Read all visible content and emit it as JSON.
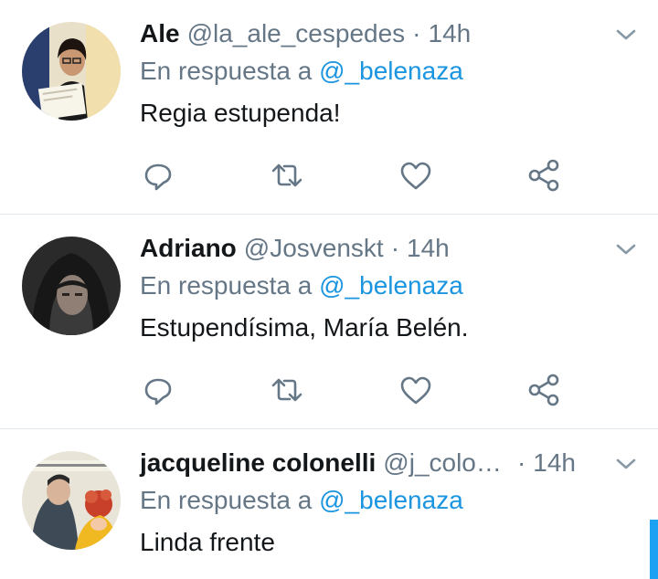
{
  "tweets": [
    {
      "name": "Ale",
      "handle": "@la_ale_cespedes",
      "separator": "·",
      "time": "14h",
      "reply_prefix": "En respuesta a",
      "reply_to": "@_belenaza",
      "text": "Regia estupenda!",
      "avatar": "avatar-photo-woman-diploma"
    },
    {
      "name": "Adriano",
      "handle": "@Josvenskt",
      "separator": "·",
      "time": "14h",
      "reply_prefix": "En respuesta a",
      "reply_to": "@_belenaza",
      "text": "Estupendísima, María Belén.",
      "avatar": "avatar-photo-man-hood"
    },
    {
      "name": "jacqueline colonelli",
      "handle": "@j_colon…",
      "separator": "·",
      "time": "14h",
      "reply_prefix": "En respuesta a",
      "reply_to": "@_belenaza",
      "text": "Linda frente",
      "avatar": "avatar-comic-illustration"
    }
  ],
  "icons": {
    "reply": "speech-bubble-icon",
    "retweet": "retweet-arrows-icon",
    "like": "heart-icon",
    "share": "share-icon",
    "menu": "chevron-down-icon"
  },
  "colors": {
    "text": "#14171a",
    "secondary": "#657786",
    "link": "#1b95e0",
    "icon": "#657786",
    "divider": "#e1e8ed"
  }
}
